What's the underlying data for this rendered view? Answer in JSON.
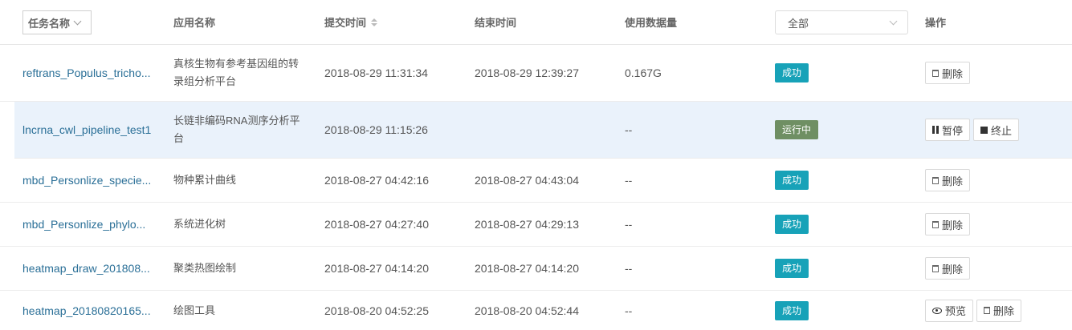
{
  "header": {
    "task_name": "任务名称",
    "app_name": "应用名称",
    "submit_time": "提交时间",
    "end_time": "结束时间",
    "data_usage": "使用数据量",
    "status_filter": "全部",
    "actions": "操作"
  },
  "rows": [
    {
      "task": "reftrans_Populus_tricho...",
      "app": "真核生物有参考基因组的转录组分析平台",
      "submit": "2018-08-29 11:31:34",
      "end": "2018-08-29 12:39:27",
      "data": "0.167G",
      "status": "成功",
      "actions": [
        "删除"
      ]
    },
    {
      "task": "lncrna_cwl_pipeline_test1",
      "app": "长链非编码RNA测序分析平台",
      "submit": "2018-08-29 11:15:26",
      "end": "",
      "data": "--",
      "status": "运行中",
      "actions": [
        "暂停",
        "终止"
      ]
    },
    {
      "task": "mbd_Personlize_specie...",
      "app": "物种累计曲线",
      "submit": "2018-08-27 04:42:16",
      "end": "2018-08-27 04:43:04",
      "data": "--",
      "status": "成功",
      "actions": [
        "删除"
      ]
    },
    {
      "task": "mbd_Personlize_phylo...",
      "app": "系统进化树",
      "submit": "2018-08-27 04:27:40",
      "end": "2018-08-27 04:29:13",
      "data": "--",
      "status": "成功",
      "actions": [
        "删除"
      ]
    },
    {
      "task": "heatmap_draw_201808...",
      "app": "聚类热图绘制",
      "submit": "2018-08-27 04:14:20",
      "end": "2018-08-27 04:14:20",
      "data": "--",
      "status": "成功",
      "actions": [
        "删除"
      ]
    },
    {
      "task": "heatmap_20180820165...",
      "app": "绘图工具",
      "submit": "2018-08-20 04:52:25",
      "end": "2018-08-20 04:52:44",
      "data": "--",
      "status": "成功",
      "actions": [
        "预览",
        "删除"
      ]
    }
  ],
  "colors": {
    "success": "#17a2b8",
    "running": "#6f8f63",
    "link": "#2a6f97",
    "highlight_row": "#eaf2fb"
  }
}
